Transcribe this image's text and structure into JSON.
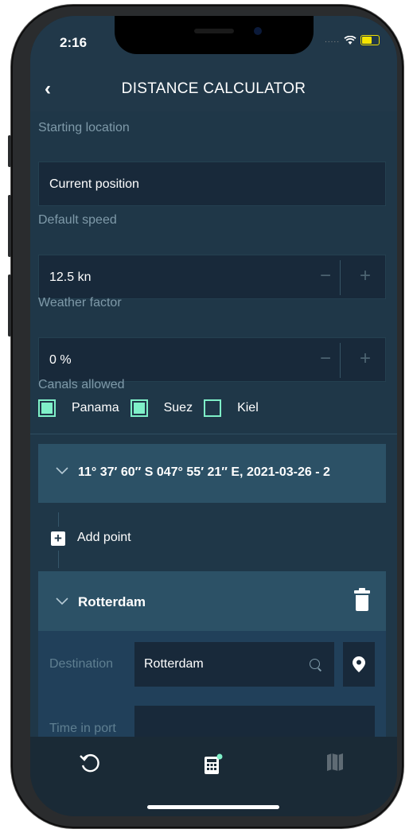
{
  "status": {
    "time": "2:16",
    "signal": "....."
  },
  "header": {
    "back": "‹",
    "title": "DISTANCE CALCULATOR"
  },
  "form": {
    "starting_location": {
      "label": "Starting location",
      "value": "Current position"
    },
    "default_speed": {
      "label": "Default speed",
      "value": "12.5 kn",
      "minus": "−",
      "plus": "+"
    },
    "weather_factor": {
      "label": "Weather factor",
      "value": "0 %",
      "minus": "−",
      "plus": "+"
    },
    "canals": {
      "label": "Canals allowed",
      "options": [
        {
          "label": "Panama",
          "checked": true
        },
        {
          "label": "Suez",
          "checked": true
        },
        {
          "label": "Kiel",
          "checked": false
        }
      ]
    }
  },
  "route": {
    "first_point": "11° 37′ 60″ S 047° 55′ 21″ E, 2021-03-26 - 2",
    "add_point_icon": "+",
    "add_point": "Add point",
    "destination_card": {
      "name": "Rotterdam",
      "destination_label": "Destination",
      "destination_value": "Rotterdam",
      "time_in_port_label": "Time in port"
    }
  },
  "icons": {
    "back": "chevron-left-icon",
    "collapse": "chevron-down-icon",
    "trash": "trash-icon",
    "search": "search-icon",
    "pin": "map-pin-icon",
    "tabs": [
      "refresh-icon",
      "calculator-icon",
      "map-icon"
    ]
  },
  "colors": {
    "header_bg": "#213849",
    "content_bg": "#1f3748",
    "field_bg": "#18293a",
    "accent_checkbox": "#7ff0c8",
    "section_bg": "#2c5166"
  }
}
